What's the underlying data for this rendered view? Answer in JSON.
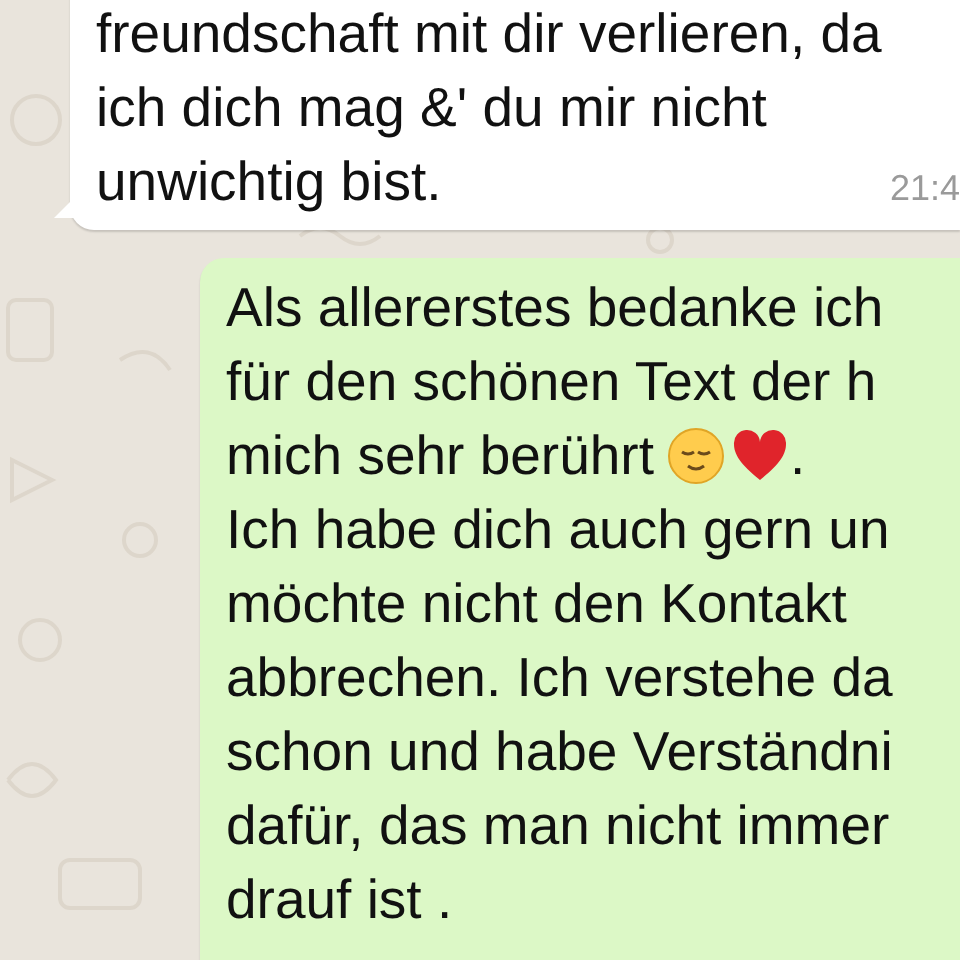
{
  "messages": [
    {
      "kind": "incoming",
      "time": "21:4",
      "lines": [
        {
          "parts": [
            {
              "kind": "text",
              "text": "freundschaft mit dir verlieren, da"
            }
          ]
        },
        {
          "parts": [
            {
              "kind": "text",
              "text": "ich dich mag &' du mir nicht"
            }
          ]
        },
        {
          "parts": [
            {
              "kind": "text",
              "text": "unwichtig bist."
            }
          ]
        }
      ]
    },
    {
      "kind": "outgoing",
      "lines": [
        {
          "parts": [
            {
              "kind": "text",
              "text": "Als allererstes bedanke ich"
            }
          ]
        },
        {
          "parts": [
            {
              "kind": "text",
              "text": "für den schönen Text der h"
            }
          ]
        },
        {
          "parts": [
            {
              "kind": "text",
              "text": "mich sehr berührt"
            },
            {
              "kind": "relieved-face"
            },
            {
              "kind": "heart"
            },
            {
              "kind": "text",
              "text": "."
            }
          ]
        },
        {
          "parts": [
            {
              "kind": "text",
              "text": "Ich habe dich auch gern un"
            }
          ]
        },
        {
          "parts": [
            {
              "kind": "text",
              "text": "möchte nicht den Kontakt"
            }
          ]
        },
        {
          "parts": [
            {
              "kind": "text",
              "text": "abbrechen. Ich verstehe da"
            }
          ]
        },
        {
          "parts": [
            {
              "kind": "text",
              "text": "schon und habe Verständni"
            }
          ]
        },
        {
          "parts": [
            {
              "kind": "text",
              "text": "dafür, das man nicht immer"
            }
          ]
        },
        {
          "parts": [
            {
              "kind": "text",
              "text": "drauf ist ."
            }
          ]
        }
      ]
    }
  ]
}
